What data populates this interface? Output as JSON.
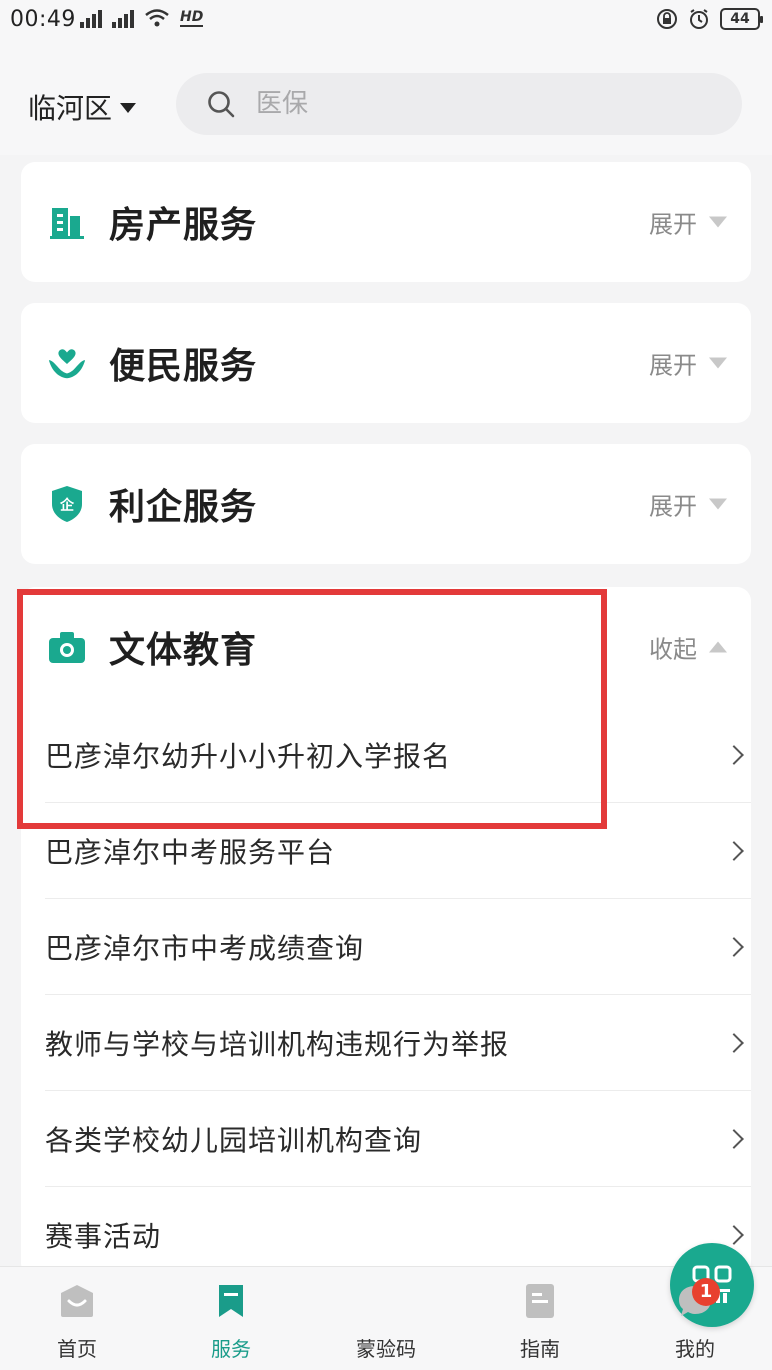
{
  "status_bar": {
    "time": "00:49",
    "network_label": "HD",
    "battery": "44"
  },
  "header": {
    "region": "临河区",
    "search_placeholder": "医保"
  },
  "sections": [
    {
      "title": "房产服务",
      "toggle": "展开"
    },
    {
      "title": "便民服务",
      "toggle": "展开"
    },
    {
      "title": "利企服务",
      "toggle": "展开"
    },
    {
      "title": "文体教育",
      "toggle": "收起",
      "items": [
        "巴彦淖尔幼升小小升初入学报名",
        "巴彦淖尔中考服务平台",
        "巴彦淖尔市中考成绩查询",
        "教师与学校与培训机构违规行为举报",
        "各类学校幼儿园培训机构查询",
        "赛事活动"
      ]
    }
  ],
  "tabbar": {
    "home": "首页",
    "service": "服务",
    "qr": "蒙验码",
    "guide": "指南",
    "mine": "我的",
    "mine_badge": "1",
    "active_color": "#1a9c8a"
  },
  "colors": {
    "accent": "#1aa98f",
    "highlight_border": "#e33a3a"
  }
}
